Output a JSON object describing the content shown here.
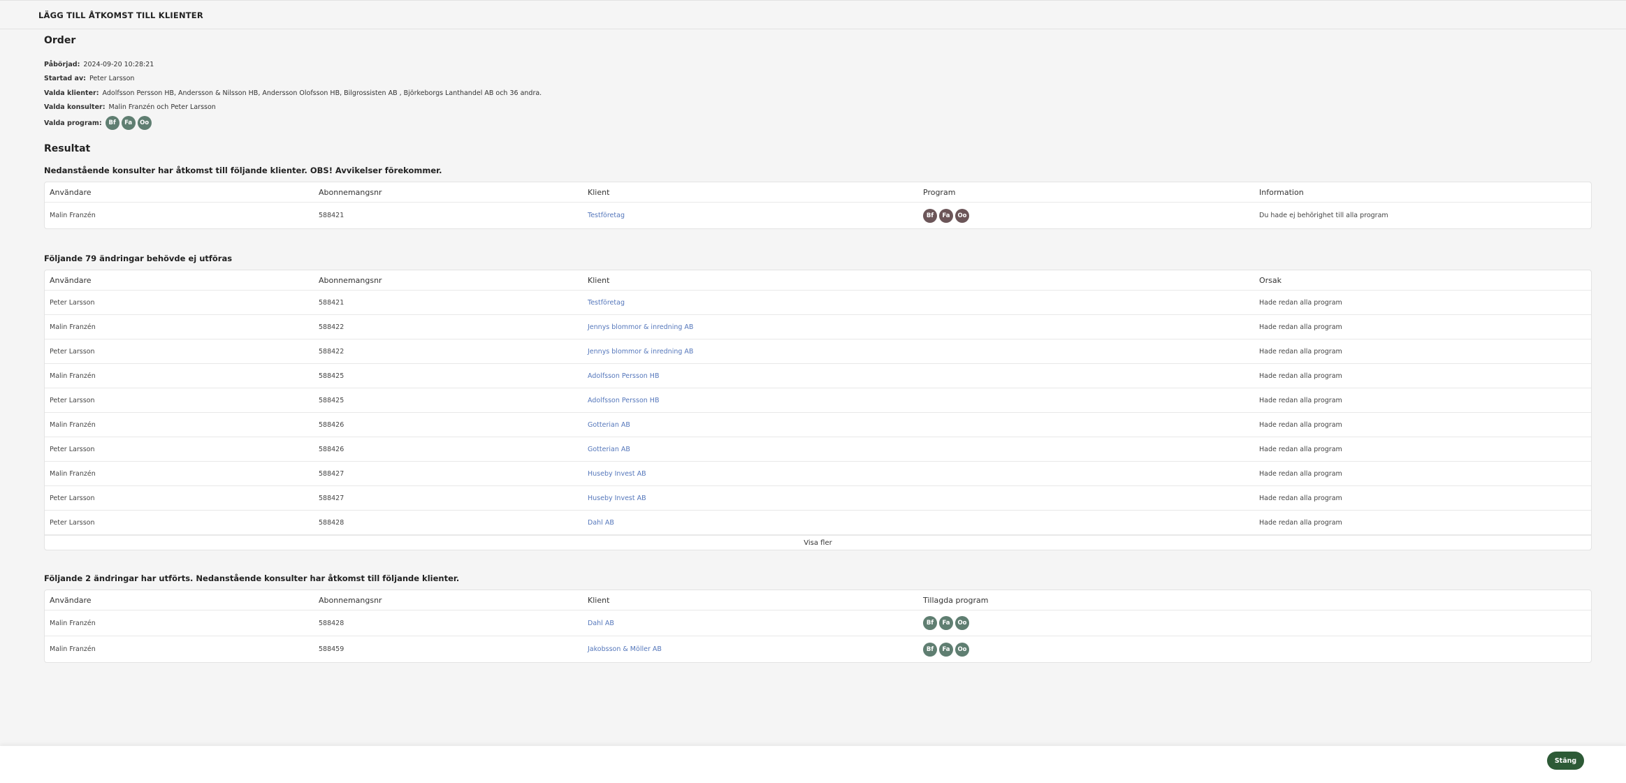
{
  "header": {
    "title": "LÄGG TILL ÅTKOMST TILL KLIENTER"
  },
  "order": {
    "title": "Order",
    "started_label": "Påbörjad:",
    "started_value": "2024-09-20 10:28:21",
    "startedby_label": "Startad av:",
    "startedby_value": "Peter Larsson",
    "clients_label": "Valda klienter:",
    "clients_value": "Adolfsson Persson HB, Andersson & Nilsson HB, Andersson Olofsson HB, Bilgrossisten AB , Björkeborgs Lanthandel AB och 36 andra.",
    "consultants_label": "Valda konsulter:",
    "consultants_value": "Malin Franzén och Peter Larsson",
    "programs_label": "Valda program:",
    "programs": [
      "Bf",
      "Fa",
      "Oo"
    ]
  },
  "result": {
    "title": "Resultat",
    "table1": {
      "heading": "Nedanstående konsulter har åtkomst till följande klienter. OBS! Avvikelser förekommer.",
      "columns": [
        "Användare",
        "Abonnemangsnr",
        "Klient",
        "Program",
        "Information"
      ],
      "rows": [
        {
          "user": "Malin Franzén",
          "sub": "588421",
          "client": "Testföretag",
          "programs": [
            "Bf",
            "Fa",
            "Oo"
          ],
          "info": "Du hade ej behörighet till alla program"
        }
      ]
    },
    "table2": {
      "heading": "Följande 79 ändringar behövde ej utföras",
      "columns": [
        "Användare",
        "Abonnemangsnr",
        "Klient",
        "Orsak"
      ],
      "rows": [
        {
          "user": "Peter Larsson",
          "sub": "588421",
          "client": "Testföretag",
          "reason": "Hade redan alla program"
        },
        {
          "user": "Malin Franzén",
          "sub": "588422",
          "client": "Jennys blommor & inredning AB",
          "reason": "Hade redan alla program"
        },
        {
          "user": "Peter Larsson",
          "sub": "588422",
          "client": "Jennys blommor & inredning AB",
          "reason": "Hade redan alla program"
        },
        {
          "user": "Malin Franzén",
          "sub": "588425",
          "client": "Adolfsson Persson HB",
          "reason": "Hade redan alla program"
        },
        {
          "user": "Peter Larsson",
          "sub": "588425",
          "client": "Adolfsson Persson HB",
          "reason": "Hade redan alla program"
        },
        {
          "user": "Malin Franzén",
          "sub": "588426",
          "client": "Gotterian AB",
          "reason": "Hade redan alla program"
        },
        {
          "user": "Peter Larsson",
          "sub": "588426",
          "client": "Gotterian AB",
          "reason": "Hade redan alla program"
        },
        {
          "user": "Malin Franzén",
          "sub": "588427",
          "client": "Huseby Invest AB",
          "reason": "Hade redan alla program"
        },
        {
          "user": "Peter Larsson",
          "sub": "588427",
          "client": "Huseby Invest AB",
          "reason": "Hade redan alla program"
        },
        {
          "user": "Peter Larsson",
          "sub": "588428",
          "client": "Dahl AB",
          "reason": "Hade redan alla program"
        }
      ],
      "more_label": "Visa fler"
    },
    "table3": {
      "heading": "Följande 2 ändringar har utförts. Nedanstående konsulter har åtkomst till följande klienter.",
      "columns": [
        "Användare",
        "Abonnemangsnr",
        "Klient",
        "Tillagda program"
      ],
      "rows": [
        {
          "user": "Malin Franzén",
          "sub": "588428",
          "client": "Dahl AB",
          "programs": [
            "Bf",
            "Fa",
            "Oo"
          ]
        },
        {
          "user": "Malin Franzén",
          "sub": "588459",
          "client": "Jakobsson & Möller AB",
          "programs": [
            "Bf",
            "Fa",
            "Oo"
          ]
        }
      ]
    }
  },
  "footer": {
    "close_label": "Stäng"
  },
  "colors": {
    "badge_green": "#5f7e71",
    "badge_brown": "#6b5558",
    "link": "#5577bb",
    "close_button": "#2d5a36"
  }
}
